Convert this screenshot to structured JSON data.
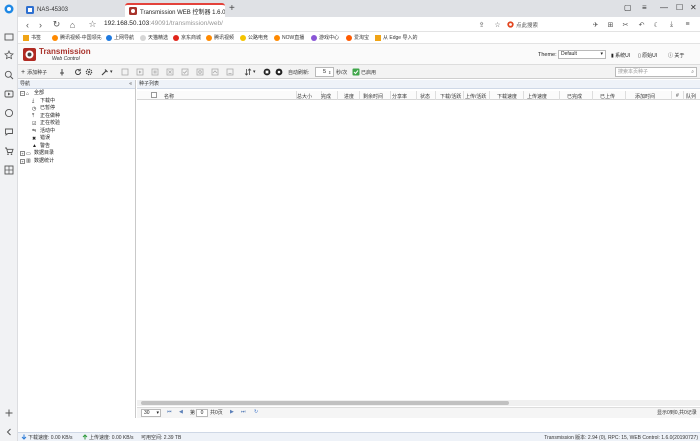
{
  "browser": {
    "tabs": [
      {
        "label": "NAS-45303"
      },
      {
        "label": "Transmission WEB 控制器 1.6.0"
      }
    ],
    "url_host": "192.168.50.103",
    "url_rest": ":49091/transmission/web/",
    "search_placeholder": "点此搜索",
    "bookmarks": [
      "书签",
      "腾讯视频-中国领先",
      "上网导航",
      "天猫精选",
      "京东商城",
      "腾讯视频",
      "公路电竞",
      "NOW直播",
      "游戏中心",
      "爱淘宝",
      "从 Edge 导入的"
    ]
  },
  "app": {
    "logo_title": "Transmission",
    "logo_subtitle": "Web Control",
    "theme_label": "Theme:",
    "theme_value": "Default",
    "system_links": [
      "系统UI",
      "原始UI",
      "关于"
    ],
    "search_placeholder": "搜索本页种子"
  },
  "toolbar": {
    "add_label": "添加种子",
    "speed_limit_label": "自动刷新:",
    "speed_limit_value": "5",
    "seconds_label": "秒/次",
    "paused_label": "已启用"
  },
  "nav_panel": {
    "title": "导航",
    "items": [
      {
        "label": "全部"
      },
      {
        "label": "下载中"
      },
      {
        "label": "已暂停"
      },
      {
        "label": "正在做种"
      },
      {
        "label": "正在校验"
      },
      {
        "label": "活动中"
      },
      {
        "label": "错误"
      },
      {
        "label": "警告"
      },
      {
        "label": "数据目录"
      },
      {
        "label": "数据统计"
      }
    ]
  },
  "list_panel": {
    "title": "种子列表",
    "columns": [
      "名称",
      "总大小",
      "完成",
      "进度",
      "剩余时间",
      "分享率",
      "状态",
      "下载/活跃",
      "上传/活跃",
      "下载速度",
      "上传速度",
      "已完成",
      "已上传",
      "添加时间",
      "#",
      "队列"
    ]
  },
  "pager": {
    "page_size": "30",
    "page_label": "第",
    "page_value": "0",
    "page_total": "共0页",
    "summary": "显示0到0,共0记录"
  },
  "status_bar": {
    "download_speed": "下载速度: 0.00 KB/s",
    "upload_speed": "上传速度: 0.00 KB/s",
    "free_space": "可用空间: 2.39 TB",
    "version": "Transmission 版本: 2.94 (0), RPC: 15, WEB Control: 1.6.0(20190727)"
  }
}
